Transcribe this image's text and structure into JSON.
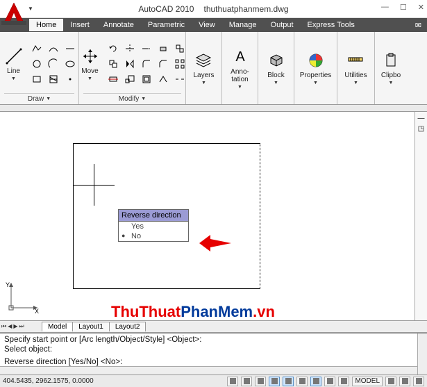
{
  "title": {
    "app": "AutoCAD 2010",
    "file": "thuthuatphanmem.dwg"
  },
  "tabs": {
    "items": [
      "Home",
      "Insert",
      "Annotate",
      "Parametric",
      "View",
      "Manage",
      "Output",
      "Express Tools"
    ],
    "active": 0
  },
  "ribbon": {
    "draw": {
      "line": "Line",
      "label": "Draw"
    },
    "modify": {
      "move": "Move",
      "label": "Modify"
    },
    "layers": {
      "label": "Layers"
    },
    "annotation": {
      "main": "Anno-\ntation"
    },
    "block": {
      "label": "Block"
    },
    "properties": {
      "label": "Properties"
    },
    "utilities": {
      "label": "Utilities"
    },
    "clipboard": {
      "label": "Clipbo"
    }
  },
  "canvas": {
    "popup_title": "Reverse direction",
    "option_yes": "Yes",
    "option_no": "No",
    "ucs_x": "X",
    "ucs_y": "Y"
  },
  "watermark": {
    "part1": "ThuThuat",
    "part2": "PhanMem",
    "part3": ".vn"
  },
  "layout_tabs": {
    "items": [
      "Model",
      "Layout1",
      "Layout2"
    ],
    "active": 0
  },
  "command": {
    "line1": "Specify start point or [Arc length/Object/Style] <Object>:",
    "line2": "Select object:",
    "line3": "Reverse direction [Yes/No] <No>:"
  },
  "status": {
    "coords": "404.5435, 2962.1575, 0.0000",
    "model": "MODEL"
  }
}
